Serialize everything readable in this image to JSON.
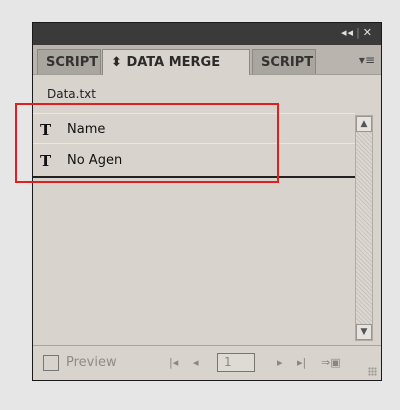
{
  "panel": {
    "title_controls": {
      "collapse": "◂◂",
      "close": "✕"
    },
    "tabs": [
      {
        "label": "SCRIPT",
        "active": false
      },
      {
        "label": "DATA MERGE",
        "icon": "⬍",
        "active": true
      },
      {
        "label": "SCRIPT",
        "active": false
      }
    ],
    "menu_icon": "▾≡",
    "source_file": "Data.txt",
    "fields": [
      {
        "icon": "T",
        "label": "Name"
      },
      {
        "icon": "T",
        "label": "No Agen"
      }
    ],
    "highlight_color": "#e02020"
  },
  "footer": {
    "preview_label": "Preview",
    "preview_checked": false,
    "page_value": "1",
    "nav_icons": {
      "first": "|◂",
      "prev": "◂",
      "next": "▸",
      "last": "▸|",
      "create_merged": "⇒▣"
    }
  }
}
